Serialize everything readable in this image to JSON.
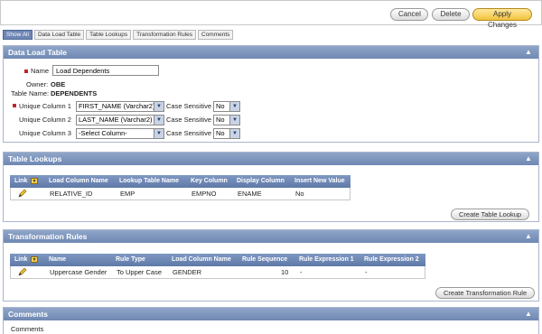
{
  "toolbar": {
    "cancel": "Cancel",
    "delete": "Delete",
    "apply": "Apply Changes"
  },
  "subtabs": [
    "Show All",
    "Data Load Table",
    "Table Lookups",
    "Transformation Rules",
    "Comments"
  ],
  "data_load_table": {
    "title": "Data Load Table",
    "name_label": "Name",
    "name_value": "Load Dependents",
    "owner_label": "Owner:",
    "owner_value": "OBE",
    "table_label": "Table Name:",
    "table_value": "DEPENDENTS",
    "unique1_label": "Unique Column 1",
    "unique1_value": "FIRST_NAME (Varchar2)",
    "unique2_label": "Unique Column 2",
    "unique2_value": "LAST_NAME (Varchar2)",
    "unique3_label": "Unique Column 3",
    "unique3_value": "-Select Column-",
    "case_label": "Case Sensitive",
    "case1": "No",
    "case2": "No",
    "case3": "No"
  },
  "table_lookups": {
    "title": "Table Lookups",
    "headers": [
      "Link",
      "Load Column Name",
      "Lookup Table Name",
      "Key Column",
      "Display Column",
      "Insert New Value"
    ],
    "rows": [
      {
        "load_column": "RELATIVE_ID",
        "lookup_table": "EMP",
        "key_column": "EMPNO",
        "display_column": "ENAME",
        "insert_new": "No"
      }
    ],
    "create_button": "Create Table Lookup"
  },
  "transformation_rules": {
    "title": "Transformation Rules",
    "headers": [
      "Link",
      "Name",
      "Rule Type",
      "Load Column Name",
      "Rule Sequence",
      "Rule Expression 1",
      "Rule Expression 2"
    ],
    "rows": [
      {
        "name": "Uppercase Gender",
        "rule_type": "To Upper Case",
        "load_column": "GENDER",
        "sequence": "10",
        "expr1": "-",
        "expr2": "-"
      }
    ],
    "create_button": "Create Transformation Rule"
  },
  "comments": {
    "title": "Comments",
    "label": "Comments"
  },
  "colors": {
    "region_header": "#7890b9",
    "required_marker": "#c0262d",
    "apply_button": "#f2c23c"
  }
}
